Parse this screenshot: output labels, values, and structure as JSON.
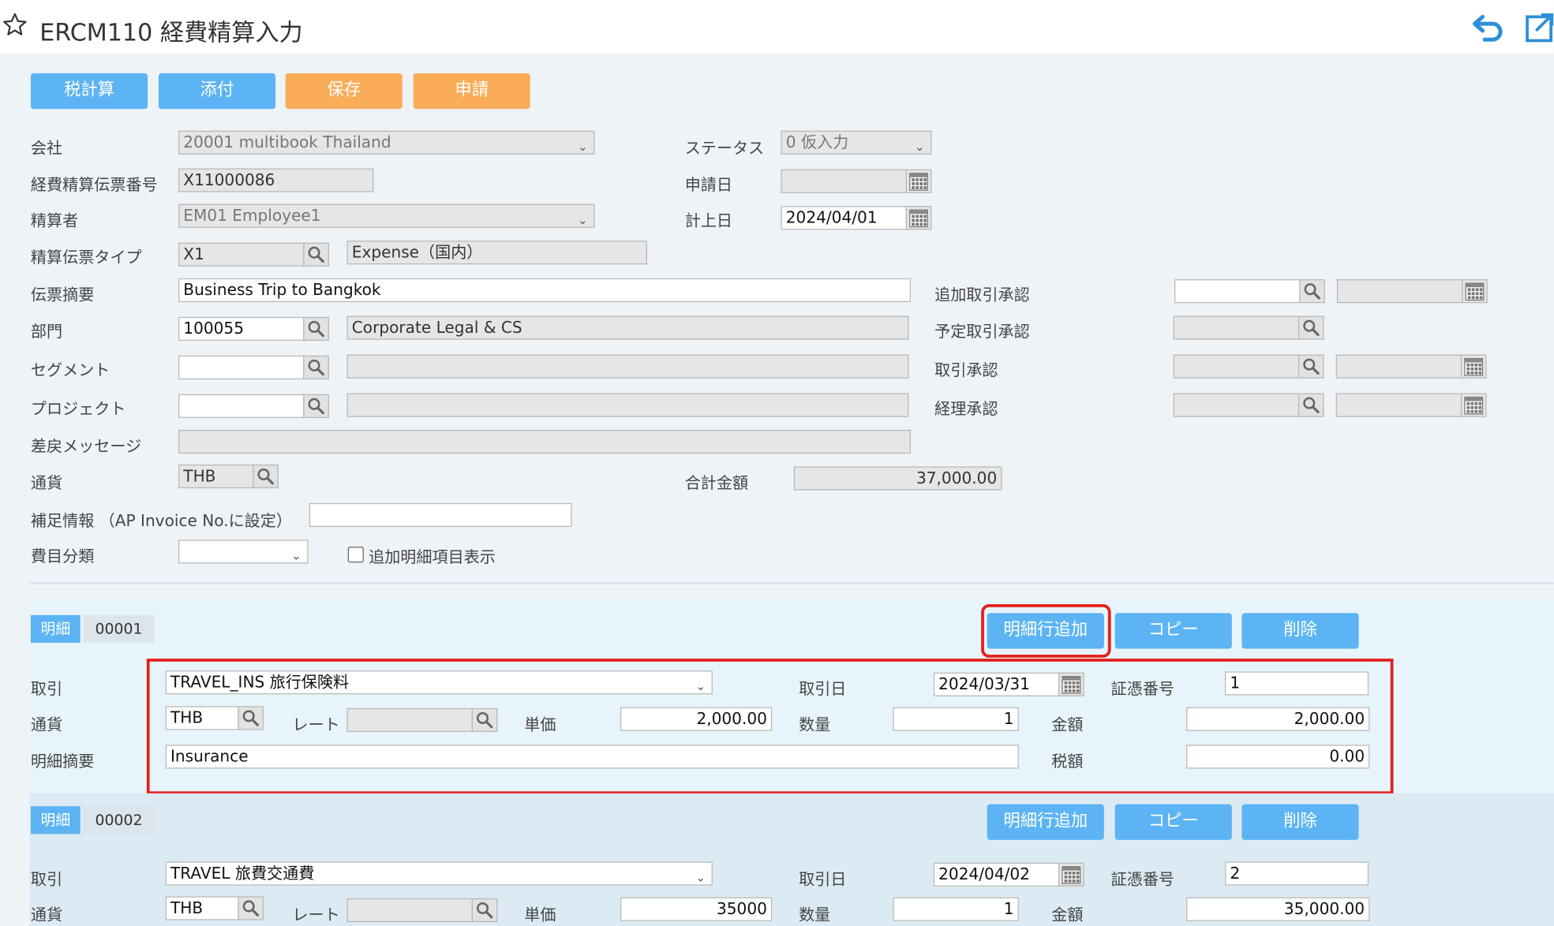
{
  "header": {
    "title": "ERCM110 経費精算入力",
    "star_icon": "star-outline-icon",
    "undo_icon": "undo-icon",
    "popout_icon": "popout-icon"
  },
  "toolbar": {
    "tax_calc": "税計算",
    "attach": "添付",
    "save": "保存",
    "apply": "申請"
  },
  "form": {
    "company_label": "会社",
    "company_value": "20001 multibook Thailand",
    "status_label": "ステータス",
    "status_value": "0 仮入力",
    "voucher_no_label": "経費精算伝票番号",
    "voucher_no_value": "X11000086",
    "apply_date_label": "申請日",
    "apply_date_value": "",
    "settler_label": "精算者",
    "settler_value": "EM01 Employee1",
    "posting_date_label": "計上日",
    "posting_date_value": "2024/04/01",
    "voucher_type_label": "精算伝票タイプ",
    "voucher_type_code": "X1",
    "voucher_type_name": "Expense（国内）",
    "summary_label": "伝票摘要",
    "summary_value": "Business Trip to  Bangkok",
    "extra_approval_label": "追加取引承認",
    "dept_label": "部門",
    "dept_code": "100055",
    "dept_name": "Corporate Legal & CS",
    "planned_approval_label": "予定取引承認",
    "segment_label": "セグメント",
    "txn_approval_label": "取引承認",
    "project_label": "プロジェクト",
    "acct_approval_label": "経理承認",
    "return_msg_label": "差戻メッセージ",
    "currency_label": "通貨",
    "currency_value": "THB",
    "total_label": "合計金額",
    "total_value": "37,000.00",
    "supplement_label": "補足情報 （AP Invoice No.に設定）",
    "expense_cat_label": "費目分類",
    "show_extra_label": "追加明細項目表示"
  },
  "details": [
    {
      "tag": "明細",
      "number": "00001",
      "add_row": "明細行追加",
      "copy": "コピー",
      "delete": "削除",
      "txn_label": "取引",
      "txn_value": "TRAVEL_INS 旅行保険料",
      "txn_date_label": "取引日",
      "txn_date_value": "2024/03/31",
      "receipt_label": "証憑番号",
      "receipt_value": "1",
      "currency_label": "通貨",
      "currency_value": "THB",
      "rate_label": "レート",
      "unit_price_label": "単価",
      "unit_price_value": "2,000.00",
      "qty_label": "数量",
      "qty_value": "1",
      "amount_label": "金額",
      "amount_value": "2,000.00",
      "memo_label": "明細摘要",
      "memo_value": "Insurance",
      "tax_label": "税額",
      "tax_value": "0.00"
    },
    {
      "tag": "明細",
      "number": "00002",
      "add_row": "明細行追加",
      "copy": "コピー",
      "delete": "削除",
      "txn_label": "取引",
      "txn_value": "TRAVEL 旅費交通費",
      "txn_date_label": "取引日",
      "txn_date_value": "2024/04/02",
      "receipt_label": "証憑番号",
      "receipt_value": "2",
      "currency_label": "通貨",
      "currency_value": "THB",
      "rate_label": "レート",
      "unit_price_label": "単価",
      "unit_price_value": "35000",
      "qty_label": "数量",
      "qty_value": "1",
      "amount_label": "金額",
      "amount_value": "35,000.00"
    }
  ],
  "colors": {
    "accent_blue": "#5cb4f4",
    "accent_orange": "#fbac58",
    "highlight_red": "#e2211c"
  }
}
